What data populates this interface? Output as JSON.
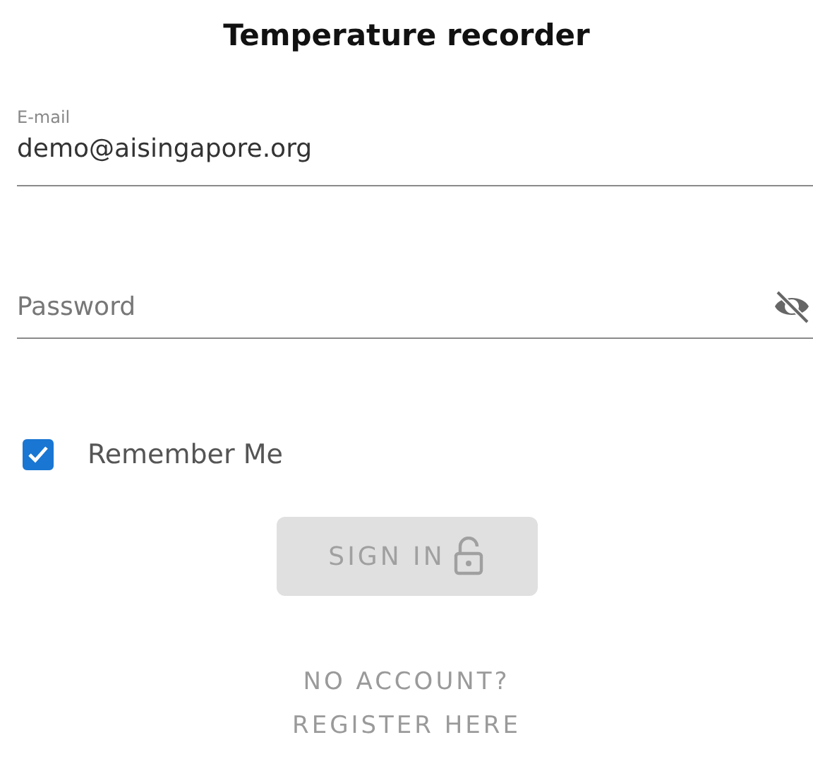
{
  "title": "Temperature recorder",
  "email": {
    "label": "E-mail",
    "value": "demo@aisingapore.org"
  },
  "password": {
    "placeholder": "Password"
  },
  "remember": {
    "label": "Remember Me",
    "checked": true
  },
  "sign_in": {
    "label": "SIGN IN",
    "disabled": true
  },
  "no_account": "NO ACCOUNT?",
  "register": "REGISTER HERE"
}
